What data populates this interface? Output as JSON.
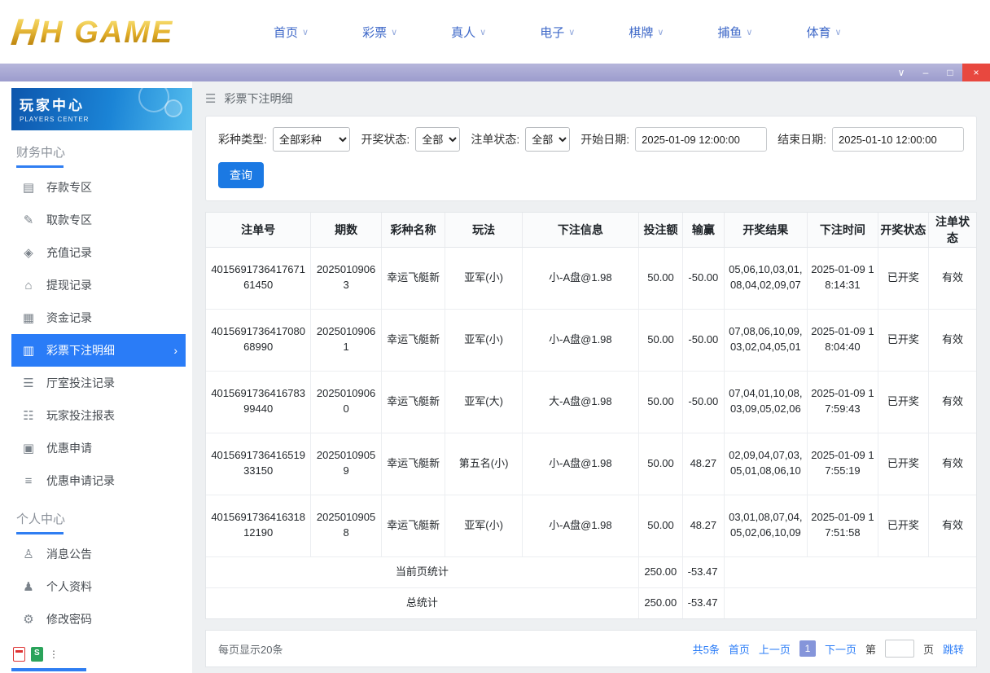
{
  "site_header": {
    "logo_emblem": "H",
    "logo_text": "H GAME",
    "nav": [
      {
        "label": "首页"
      },
      {
        "label": "彩票"
      },
      {
        "label": "真人"
      },
      {
        "label": "电子"
      },
      {
        "label": "棋牌"
      },
      {
        "label": "捕鱼"
      },
      {
        "label": "体育"
      }
    ],
    "nav_chevron": "∨"
  },
  "window_controls": {
    "dropdown": "∨",
    "minimize": "–",
    "maximize": "□",
    "close": "×"
  },
  "sidebar": {
    "banner": {
      "title": "玩家中心",
      "subtitle": "PLAYERS CENTER"
    },
    "active_chevron": "›",
    "sections": [
      {
        "label": "财务中心",
        "items": [
          {
            "label": "存款专区",
            "icon_name": "deposit-icon",
            "icon": "▤"
          },
          {
            "label": "取款专区",
            "icon_name": "withdraw-icon",
            "icon": "✎"
          },
          {
            "label": "充值记录",
            "icon_name": "recharge-record-icon",
            "icon": "◈"
          },
          {
            "label": "提现记录",
            "icon_name": "withdrawal-record-icon",
            "icon": "⌂"
          },
          {
            "label": "资金记录",
            "icon_name": "funds-record-icon",
            "icon": "▦"
          },
          {
            "label": "彩票下注明细",
            "icon_name": "lottery-bet-detail-icon",
            "icon": "▥"
          },
          {
            "label": "厅室投注记录",
            "icon_name": "hall-bet-record-icon",
            "icon": "☰"
          },
          {
            "label": "玩家投注报表",
            "icon_name": "player-bet-report-icon",
            "icon": "☷"
          },
          {
            "label": "优惠申请",
            "icon_name": "promo-apply-icon",
            "icon": "▣"
          },
          {
            "label": "优惠申请记录",
            "icon_name": "promo-record-icon",
            "icon": "≡"
          }
        ]
      },
      {
        "label": "个人中心",
        "items": [
          {
            "label": "消息公告",
            "icon_name": "announcement-icon",
            "icon": "♙"
          },
          {
            "label": "个人资料",
            "icon_name": "profile-icon",
            "icon": "♟"
          },
          {
            "label": "修改密码",
            "icon_name": "change-password-icon",
            "icon": "⚙"
          }
        ]
      }
    ]
  },
  "main": {
    "menu_icon": "☰",
    "page_title": "彩票下注明细",
    "filters": {
      "lottery_type_label": "彩种类型:",
      "lottery_type_value": "全部彩种",
      "draw_status_label": "开奖状态:",
      "draw_status_value": "全部",
      "order_status_label": "注单状态:",
      "order_status_value": "全部",
      "start_date_label": "开始日期:",
      "start_date_value": "2025-01-09 12:00:00",
      "end_date_label": "结束日期:",
      "end_date_value": "2025-01-10 12:00:00",
      "search_button": "查询"
    },
    "table": {
      "headers": [
        "注单号",
        "期数",
        "彩种名称",
        "玩法",
        "下注信息",
        "投注额",
        "输赢",
        "开奖结果",
        "下注时间",
        "开奖状态",
        "注单状态"
      ],
      "rows": [
        {
          "order_id": "401569173641767161450",
          "period": "20250109063",
          "lottery": "幸运飞艇新",
          "play": "亚军(小)",
          "bet_info": "小-A盘@1.98",
          "bet_amount": "50.00",
          "win_loss": "-50.00",
          "result": "05,06,10,03,01,08,04,02,09,07",
          "bet_time": "2025-01-09 18:14:31",
          "draw_status": "已开奖",
          "order_status": "有效"
        },
        {
          "order_id": "401569173641708068990",
          "period": "20250109061",
          "lottery": "幸运飞艇新",
          "play": "亚军(小)",
          "bet_info": "小-A盘@1.98",
          "bet_amount": "50.00",
          "win_loss": "-50.00",
          "result": "07,08,06,10,09,03,02,04,05,01",
          "bet_time": "2025-01-09 18:04:40",
          "draw_status": "已开奖",
          "order_status": "有效"
        },
        {
          "order_id": "401569173641678399440",
          "period": "20250109060",
          "lottery": "幸运飞艇新",
          "play": "亚军(大)",
          "bet_info": "大-A盘@1.98",
          "bet_amount": "50.00",
          "win_loss": "-50.00",
          "result": "07,04,01,10,08,03,09,05,02,06",
          "bet_time": "2025-01-09 17:59:43",
          "draw_status": "已开奖",
          "order_status": "有效"
        },
        {
          "order_id": "401569173641651933150",
          "period": "20250109059",
          "lottery": "幸运飞艇新",
          "play": "第五名(小)",
          "bet_info": "小-A盘@1.98",
          "bet_amount": "50.00",
          "win_loss": "48.27",
          "result": "02,09,04,07,03,05,01,08,06,10",
          "bet_time": "2025-01-09 17:55:19",
          "draw_status": "已开奖",
          "order_status": "有效"
        },
        {
          "order_id": "401569173641631812190",
          "period": "20250109058",
          "lottery": "幸运飞艇新",
          "play": "亚军(小)",
          "bet_info": "小-A盘@1.98",
          "bet_amount": "50.00",
          "win_loss": "48.27",
          "result": "03,01,08,07,04,05,02,06,10,09",
          "bet_time": "2025-01-09 17:51:58",
          "draw_status": "已开奖",
          "order_status": "有效"
        }
      ],
      "summary": [
        {
          "label": "当前页统计",
          "bet_amount": "250.00",
          "win_loss": "-53.47"
        },
        {
          "label": "总统计",
          "bet_amount": "250.00",
          "win_loss": "-53.47"
        }
      ]
    },
    "pagination": {
      "page_size_text": "每页显示20条",
      "total_text": "共5条",
      "first": "首页",
      "prev": "上一页",
      "current_page": "1",
      "next": "下一页",
      "jump_prefix": "第",
      "jump_suffix": "页",
      "jump_button": "跳转"
    }
  }
}
